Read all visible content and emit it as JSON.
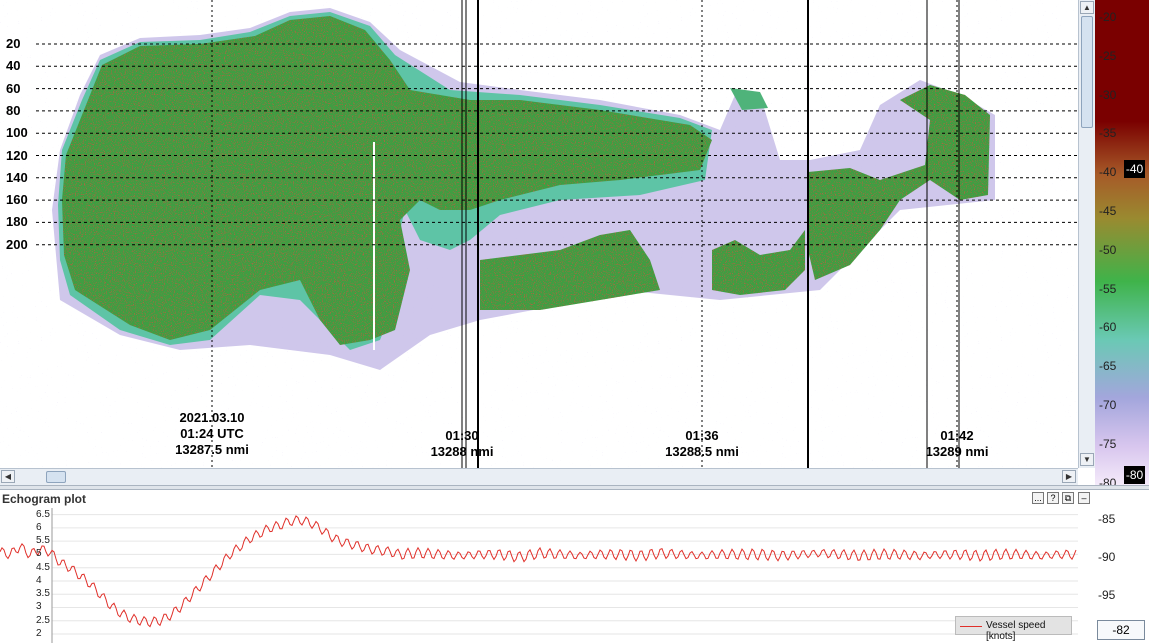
{
  "echogram": {
    "depth_labels": [
      "20",
      "40",
      "60",
      "80",
      "100",
      "120",
      "140",
      "160",
      "180",
      "200"
    ],
    "time_markers": [
      {
        "date": "2021.03.10",
        "time": "01:24 UTC",
        "distance": "13287.5 nmi"
      },
      {
        "date": "",
        "time": "01:30",
        "distance": "13288 nmi"
      },
      {
        "date": "",
        "time": "01:36",
        "distance": "13288.5 nmi"
      },
      {
        "date": "",
        "time": "01:42",
        "distance": "13289 nmi"
      }
    ]
  },
  "colorbar": {
    "labels": [
      "-20",
      "-25",
      "-30",
      "-35",
      "-40",
      "-45",
      "-50",
      "-55",
      "-60",
      "-65",
      "-70",
      "-75",
      "-80"
    ],
    "marker_value": "-40",
    "bottom_marker": "-80",
    "colors": [
      "#7a0000",
      "#8b1a00",
      "#9b3a10",
      "#a65a28",
      "#9a7030",
      "#8a8a2e",
      "#6aa63a",
      "#3fb34a",
      "#4ec07e",
      "#6ac9b4",
      "#9bb0dc",
      "#c4b4e6",
      "#ecdcf3"
    ]
  },
  "panel": {
    "title": "Echogram plot",
    "buttons": [
      "...",
      "?",
      "⧉",
      "–"
    ],
    "y_left": [
      "6.5",
      "6",
      "5.5",
      "5",
      "4.5",
      "4",
      "3.5",
      "3",
      "2.5",
      "2"
    ],
    "y_right": [
      "-85",
      "-90",
      "-95"
    ],
    "legend_label": "Vessel speed [knots]",
    "readout_value": "-82",
    "line_color": "#e0302a"
  },
  "chart_data": {
    "type": "line",
    "title": "",
    "xlabel": "",
    "ylabel": "",
    "ylim": [
      2,
      6.6
    ],
    "series": [
      {
        "name": "Vessel speed [knots]",
        "x": [
          0,
          10,
          20,
          30,
          40,
          50,
          60,
          70,
          80,
          90,
          100,
          110,
          120,
          130,
          140,
          150,
          160,
          170,
          180,
          190,
          200,
          210,
          220,
          230,
          240,
          250,
          260,
          270,
          280,
          290,
          300,
          310,
          320,
          330,
          340,
          350,
          360,
          370,
          380,
          390,
          400,
          420,
          440,
          460,
          480,
          500,
          520,
          540,
          560,
          580,
          600,
          620,
          640,
          660,
          680,
          700,
          720,
          740,
          760,
          780,
          800,
          820,
          840,
          860,
          880,
          900,
          920,
          940,
          960,
          980,
          1000,
          1020,
          1040,
          1060,
          1077
        ],
        "values": [
          5.1,
          5.0,
          5.3,
          5.0,
          5.2,
          5.1,
          4.7,
          4.5,
          4.2,
          3.9,
          3.5,
          3.1,
          2.8,
          2.6,
          2.5,
          2.45,
          2.5,
          2.7,
          3.0,
          3.4,
          3.8,
          4.2,
          4.6,
          5.0,
          5.3,
          5.6,
          5.8,
          6.0,
          6.1,
          6.25,
          6.3,
          6.2,
          6.0,
          5.7,
          5.5,
          5.4,
          5.3,
          5.2,
          5.15,
          5.1,
          5.0,
          5.05,
          5.0,
          4.95,
          5.0,
          5.0,
          4.9,
          5.05,
          5.0,
          4.95,
          5.0,
          5.0,
          4.95,
          5.05,
          5.0,
          4.95,
          5.0,
          5.0,
          5.0,
          4.95,
          5.0,
          5.05,
          5.0,
          4.95,
          5.0,
          5.0,
          4.95,
          5.0,
          5.0,
          4.95,
          5.0,
          5.0,
          4.95,
          5.0,
          5.0
        ]
      }
    ]
  }
}
